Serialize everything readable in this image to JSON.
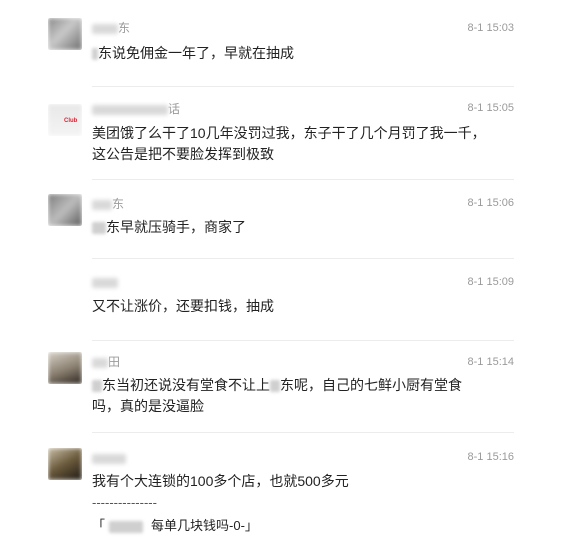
{
  "comments": [
    {
      "username": "东",
      "time": "8-1 15:03",
      "text": "东说免佣金一年了，早就在抽成"
    },
    {
      "username": "话",
      "badge": "Club",
      "time": "8-1 15:05",
      "text_line1": "美团饿了么干了10几年没罚过我，东子干了几个月罚了我一千，",
      "text_line2": "这公告是把不要脸发挥到极致"
    },
    {
      "username": "东",
      "time": "8-1 15:06",
      "text": "东早就压骑手，商家了"
    },
    {
      "username": "",
      "time": "8-1 15:09",
      "text": "又不让涨价，还要扣钱，抽成"
    },
    {
      "username": "田",
      "time": "8-1 15:14",
      "text_line1_a": "东当初还说没有堂食不让上",
      "text_line1_b": "东呢，自己的七鲜小厨有堂食",
      "text_line2": "吗，真的是没逼脸"
    },
    {
      "username": "",
      "time": "8-1 15:16",
      "text": "我有个大连锁的100多个店，也就500多元",
      "separator": "---------------",
      "quote_open": "「",
      "quote_text": "每单几块钱吗-0-」"
    }
  ],
  "colors": {
    "text": "#222222",
    "meta": "#9a9a9a",
    "divider": "#ececec"
  }
}
